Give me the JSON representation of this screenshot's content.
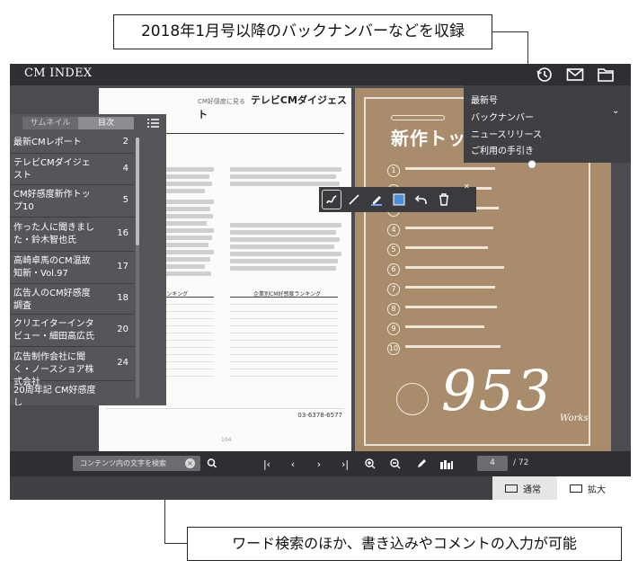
{
  "callouts": {
    "top": "2018年1月号以降のバックナンバーなどを収録",
    "bottom": "ワード検索のほか、書き込みやコメントの入力が可能"
  },
  "app": {
    "brand": "CM INDEX",
    "toolbar_icons": [
      "history-icon",
      "mail-icon",
      "folder-icon"
    ]
  },
  "menu": {
    "items": [
      "最新号",
      "バックナンバー",
      "ニュースリリース",
      "ご利用の手引き"
    ]
  },
  "sidebar": {
    "tabs": [
      "サムネイル",
      "目次"
    ],
    "active_tab": "目次",
    "items": [
      {
        "label": "最新CMレポート",
        "page": "2"
      },
      {
        "label": "テレビCMダイジェスト",
        "page": "4"
      },
      {
        "label": "CM好感度新作トップ10",
        "page": "5"
      },
      {
        "label": "作った人に聞きました・鈴木智也氏",
        "page": "16"
      },
      {
        "label": "高崎卓馬のCM温故知新・Vol.97",
        "page": "17"
      },
      {
        "label": "広告人のCM好感度調査",
        "page": "18"
      },
      {
        "label": "クリエイターインタビュー・細田高広氏",
        "page": "20"
      },
      {
        "label": "広告制作会社に聞く・ノースショア株式会社",
        "page": "24"
      },
      {
        "label": "20周年記 CM好感度し",
        "page": ""
      }
    ]
  },
  "page_left": {
    "header_small": "CM好感度に見る",
    "header": "テレビCMダイジェスト",
    "ranking_left": "好感度CM最新ランキング",
    "ranking_right": "企業別CM好感度ランキング",
    "phone": "03-6378-6577",
    "page_number": "104"
  },
  "page_right": {
    "title": "新作トップ",
    "numbers": [
      "1",
      "2",
      "3",
      "4",
      "5",
      "6",
      "7",
      "8",
      "9",
      "10"
    ],
    "big_number": "953",
    "works_label": "Works"
  },
  "bottom": {
    "search_placeholder": "コンテンツ内の文字を検索",
    "current_page": "4",
    "total_pages": "/ 72",
    "view_normal": "通常",
    "view_zoom": "拡大"
  }
}
